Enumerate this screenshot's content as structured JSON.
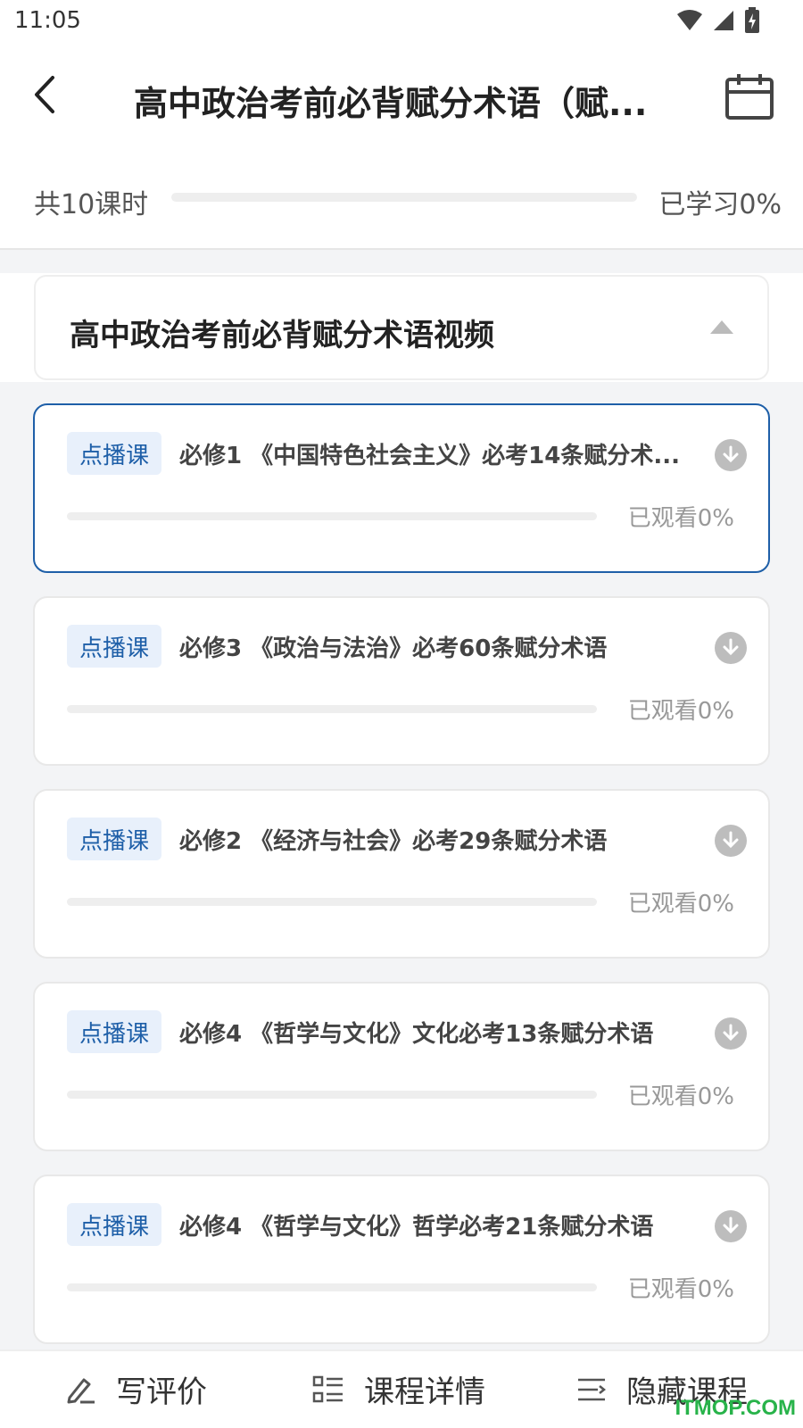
{
  "status_bar": {
    "time": "11:05"
  },
  "header": {
    "title": "高中政治考前必背赋分术语（赋..."
  },
  "summary": {
    "count_label": "共10课时",
    "progress": 0,
    "progress_label": "已学习0%"
  },
  "section": {
    "title": "高中政治考前必背赋分术语视频"
  },
  "lessons": [
    {
      "tag": "点播课",
      "title": "必修1 《中国特色社会主义》必考14条赋分术...",
      "progress": 0,
      "progress_label": "已观看0%"
    },
    {
      "tag": "点播课",
      "title": "必修3 《政治与法治》必考60条赋分术语",
      "progress": 0,
      "progress_label": "已观看0%"
    },
    {
      "tag": "点播课",
      "title": "必修2 《经济与社会》必考29条赋分术语",
      "progress": 0,
      "progress_label": "已观看0%"
    },
    {
      "tag": "点播课",
      "title": "必修4 《哲学与文化》文化必考13条赋分术语",
      "progress": 0,
      "progress_label": "已观看0%"
    },
    {
      "tag": "点播课",
      "title": "必修4 《哲学与文化》哲学必考21条赋分术语",
      "progress": 0,
      "progress_label": "已观看0%"
    }
  ],
  "bottom_bar": {
    "review_label": "写评价",
    "details_label": "课程详情",
    "hide_label": "隐藏课程"
  },
  "watermark": "ITMOP.COM",
  "colors": {
    "accent": "#1e5fa8",
    "tag_bg": "#e8f0fb",
    "watermark": "#28b34a"
  }
}
